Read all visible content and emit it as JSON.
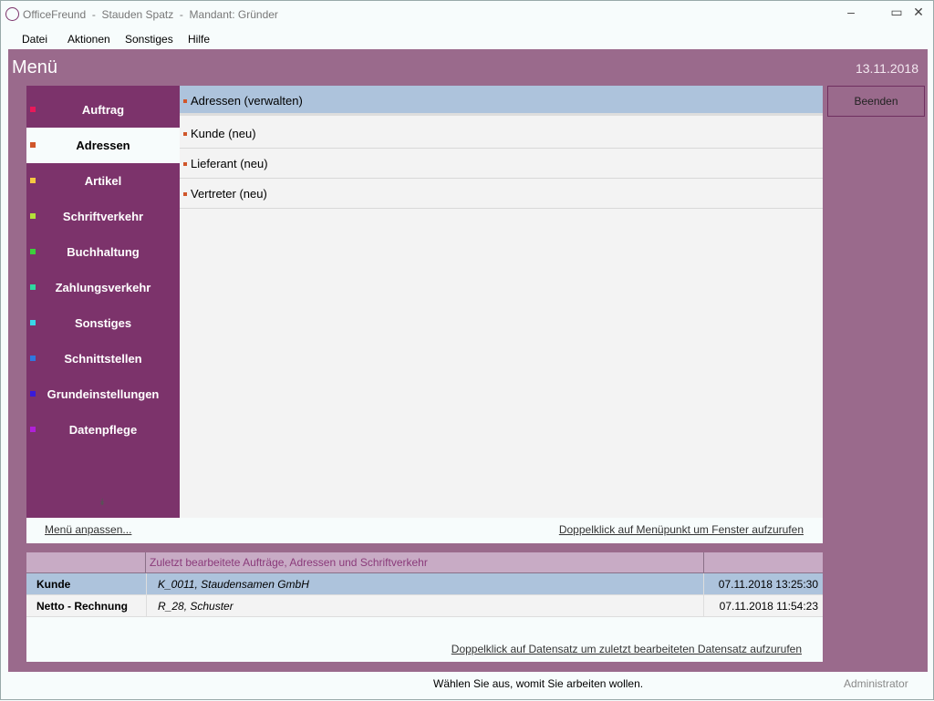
{
  "window": {
    "title": "OfficeFreund  -  Stauden Spatz  -  Mandant: Gründer",
    "minimize": "–",
    "maximize": "▭",
    "close": "✕"
  },
  "menubar": [
    "Datei",
    "Aktionen",
    "Sonstiges",
    "Hilfe"
  ],
  "header": {
    "title": "Menü",
    "date": "13.11.2018"
  },
  "sidebar": {
    "items": [
      {
        "label": "Auftrag",
        "color": "#e8195a"
      },
      {
        "label": "Adressen",
        "color": "#d0562a"
      },
      {
        "label": "Artikel",
        "color": "#f5c842"
      },
      {
        "label": "Schriftverkehr",
        "color": "#b5e03a"
      },
      {
        "label": "Buchhaltung",
        "color": "#3ccf3c"
      },
      {
        "label": "Zahlungsverkehr",
        "color": "#2fd8a0"
      },
      {
        "label": "Sonstiges",
        "color": "#38d8e8"
      },
      {
        "label": "Schnittstellen",
        "color": "#2e78e0"
      },
      {
        "label": "Grundeinstellungen",
        "color": "#3a1ad8"
      },
      {
        "label": "Datenpflege",
        "color": "#b020d8"
      }
    ],
    "more": "⯯"
  },
  "content": {
    "items": [
      "Adressen (verwalten)",
      "Kunde (neu)",
      "Lieferant (neu)",
      "Vertreter (neu)"
    ]
  },
  "links": {
    "customize": "Menü anpassen...",
    "hint": "Doppelklick auf Menüpunkt um Fenster aufzurufen"
  },
  "buttons": {
    "quit": "Beenden"
  },
  "recent": {
    "header": "Zuletzt bearbeitete Aufträge, Adressen und Schriftverkehr",
    "rows": [
      {
        "type": "Kunde",
        "record": "K_0011, Staudensamen GmbH",
        "time": "07.11.2018 13:25:30"
      },
      {
        "type": "Netto - Rechnung",
        "record": "R_28, Schuster",
        "time": "07.11.2018 11:54:23"
      }
    ],
    "hint": "Doppelklick auf Datensatz um zuletzt bearbeiteten Datensatz aufzurufen"
  },
  "status": {
    "message": "Wählen Sie aus, womit Sie arbeiten wollen.",
    "user": "Administrator"
  }
}
